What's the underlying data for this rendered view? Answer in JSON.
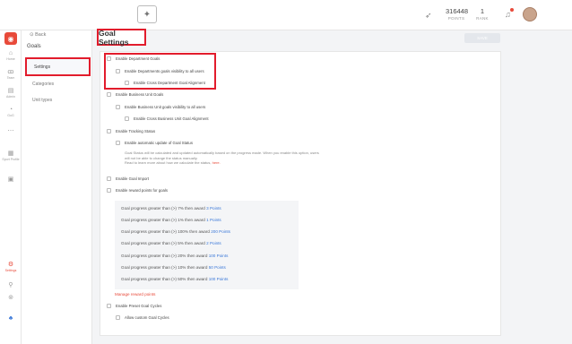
{
  "topbar": {
    "logo_glyph": "✦",
    "points_value": "316448",
    "points_label": "POINTS",
    "rank_value": "1",
    "rank_label": "RANK"
  },
  "rail": {
    "items": [
      {
        "label": "Home",
        "icon": "home-icon"
      },
      {
        "label": "Team",
        "icon": "team-icon"
      },
      {
        "label": "Admin",
        "icon": "admin-icon"
      },
      {
        "label": "GoG",
        "icon": "gog-icon"
      },
      {
        "label": "Sport Profile",
        "icon": "sport-profile-icon"
      },
      {
        "label": "Settings",
        "icon": "settings-icon"
      }
    ],
    "accent": "#e84a3a"
  },
  "subnav": {
    "back_label": "Back",
    "title": "Goals",
    "items": [
      "Settings",
      "Categories",
      "Unit types"
    ]
  },
  "page": {
    "title": "Goal Settings",
    "save_label": "SAVE"
  },
  "settings": {
    "enable_department_goals": "Enable Department Goals",
    "dept_visibility": "Enable Departments goals visibility to all users",
    "cross_dept_alignment": "Enable Cross Department Goal Alignment",
    "enable_bu_goals": "Enable Business Unit Goals",
    "bu_visibility": "Enable Business Unit goals visibility to all users",
    "cross_bu_alignment": "Enable Cross Business Unit Goal Alignment",
    "enable_tracking_status": "Enable Tracking Status",
    "auto_update_status": "Enable automatic update of Goal Status",
    "status_desc_line1": "Goal Status will be calculated and updated automatically based on the progress made. When you enable this option, users",
    "status_desc_line2": "will not be able to change the status manually.",
    "status_desc_line3": "Read to learn more about how we calculate the status,",
    "status_desc_link": "here.",
    "enable_goal_import": "Enable Goal Import",
    "enable_reward_points": "Enable reward points for goals",
    "enable_preset_cycles": "Enable Preset Goal Cycles",
    "allow_custom_cycles": "Allow custom Goal Cycles"
  },
  "rewards": [
    {
      "text": "Goal progress greater than (>) 7% then award",
      "points": "3 Points"
    },
    {
      "text": "Goal progress greater than (>) 1% then award",
      "points": "1 Points"
    },
    {
      "text": "Goal progress greater than (>) 100% then award",
      "points": "200 Points"
    },
    {
      "text": "Goal progress greater than (>) 5% then award",
      "points": "2 Points"
    },
    {
      "text": "Goal progress greater than (>) 20% then award",
      "points": "100 Points"
    },
    {
      "text": "Goal progress greater than (>) 10% then award",
      "points": "50 Points"
    },
    {
      "text": "Goal progress greater than (>) 50% then award",
      "points": "100 Points"
    }
  ],
  "manage_rewards_label": "Manage reward points"
}
